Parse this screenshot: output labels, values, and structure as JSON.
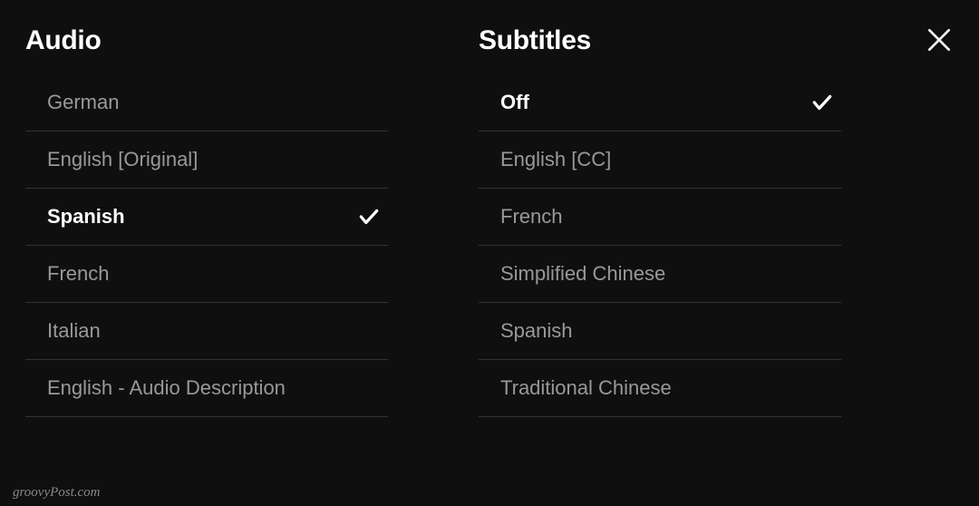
{
  "audio": {
    "heading": "Audio",
    "selected_index": 2,
    "items": [
      {
        "label": "German"
      },
      {
        "label": "English [Original]"
      },
      {
        "label": "Spanish"
      },
      {
        "label": "French"
      },
      {
        "label": "Italian"
      },
      {
        "label": "English - Audio Description"
      }
    ]
  },
  "subtitles": {
    "heading": "Subtitles",
    "selected_index": 0,
    "items": [
      {
        "label": "Off"
      },
      {
        "label": "English [CC]"
      },
      {
        "label": "French"
      },
      {
        "label": "Simplified Chinese"
      },
      {
        "label": "Spanish"
      },
      {
        "label": "Traditional Chinese"
      }
    ]
  },
  "watermark": "groovyPost.com"
}
